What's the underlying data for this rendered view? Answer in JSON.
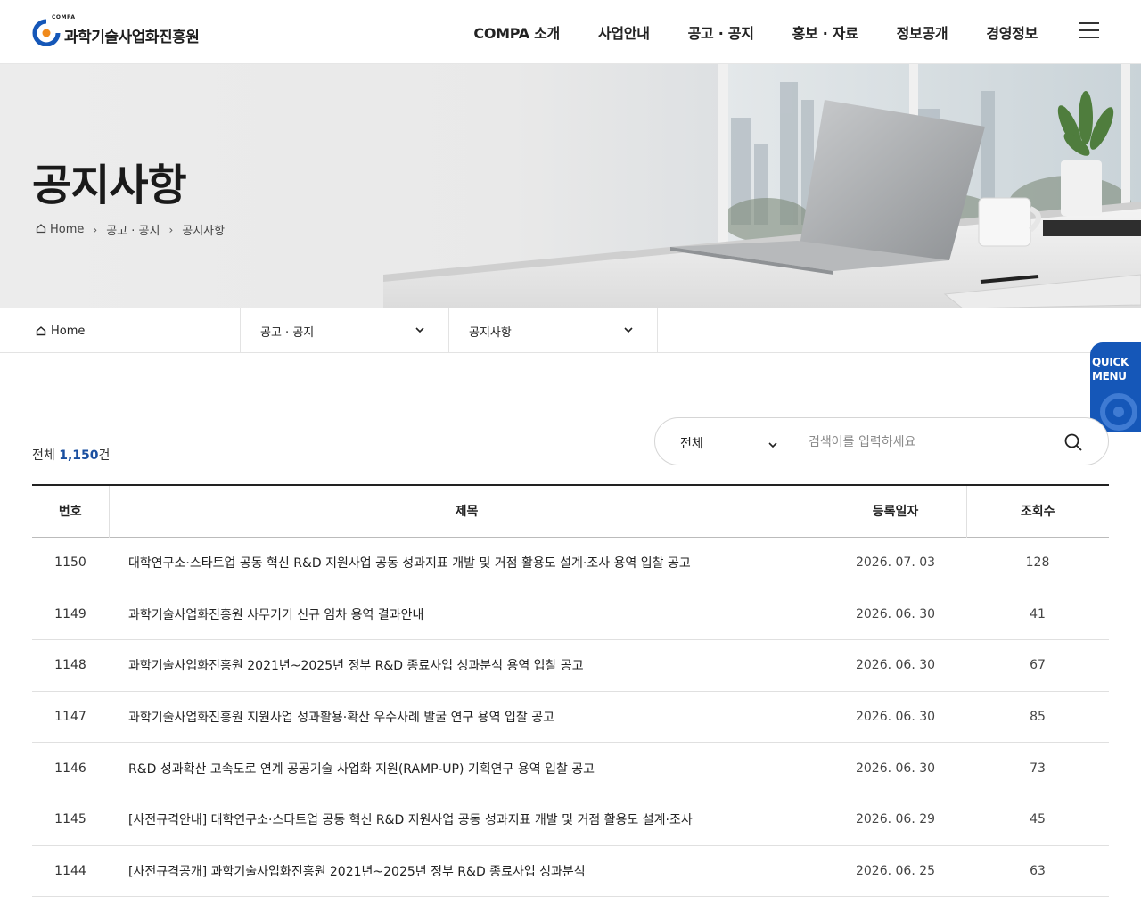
{
  "header": {
    "logo_sup": "COMPA",
    "logo_text": "과학기술사업화진흥원",
    "nav": [
      "COMPA 소개",
      "사업안내",
      "공고 · 공지",
      "홍보 · 자료",
      "정보공개",
      "경영정보"
    ]
  },
  "hero": {
    "title": "공지사항",
    "breadcrumb": [
      "Home",
      "공고 · 공지",
      "공지사항"
    ]
  },
  "subnav": {
    "home": "Home",
    "level1": "공고 · 공지",
    "level2": "공지사항"
  },
  "quick_menu": {
    "line1": "QUICK",
    "line2": "MENU"
  },
  "list": {
    "total_label": "전체",
    "total_count": "1,150",
    "total_unit": "건"
  },
  "search": {
    "scope": "전체",
    "placeholder": "검색어를 입력하세요"
  },
  "table": {
    "headers": {
      "no": "번호",
      "title": "제목",
      "date": "등록일자",
      "views": "조회수"
    },
    "rows": [
      {
        "no": "1150",
        "title": "대학연구소·스타트업 공동 혁신 R&D 지원사업 공동 성과지표 개발 및 거점 활용도 설계·조사 용역 입찰 공고",
        "date": "2026. 07. 03",
        "views": "128"
      },
      {
        "no": "1149",
        "title": "과학기술사업화진흥원 사무기기 신규 임차 용역 결과안내",
        "date": "2026. 06. 30",
        "views": "41"
      },
      {
        "no": "1148",
        "title": "과학기술사업화진흥원 2021년~2025년 정부 R&D 종료사업 성과분석 용역 입찰 공고",
        "date": "2026. 06. 30",
        "views": "67"
      },
      {
        "no": "1147",
        "title": "과학기술사업화진흥원 지원사업 성과활용·확산 우수사례 발굴 연구 용역 입찰 공고",
        "date": "2026. 06. 30",
        "views": "85"
      },
      {
        "no": "1146",
        "title": "R&D 성과확산 고속도로 연계 공공기술 사업화 지원(RAMP-UP) 기획연구 용역 입찰 공고",
        "date": "2026. 06. 30",
        "views": "73"
      },
      {
        "no": "1145",
        "title": "[사전규격안내] 대학연구소·스타트업 공동 혁신 R&D 지원사업 공동 성과지표 개발 및 거점 활용도 설계·조사",
        "date": "2026. 06. 29",
        "views": "45"
      },
      {
        "no": "1144",
        "title": "[사전규격공개] 과학기술사업화진흥원 2021년~2025년 정부 R&D 종료사업 성과분석",
        "date": "2026. 06. 25",
        "views": "63"
      }
    ]
  },
  "colors": {
    "brand_blue": "#1557b8",
    "accent_number": "#1a4fa0",
    "logo_orange": "#f08a1c"
  }
}
